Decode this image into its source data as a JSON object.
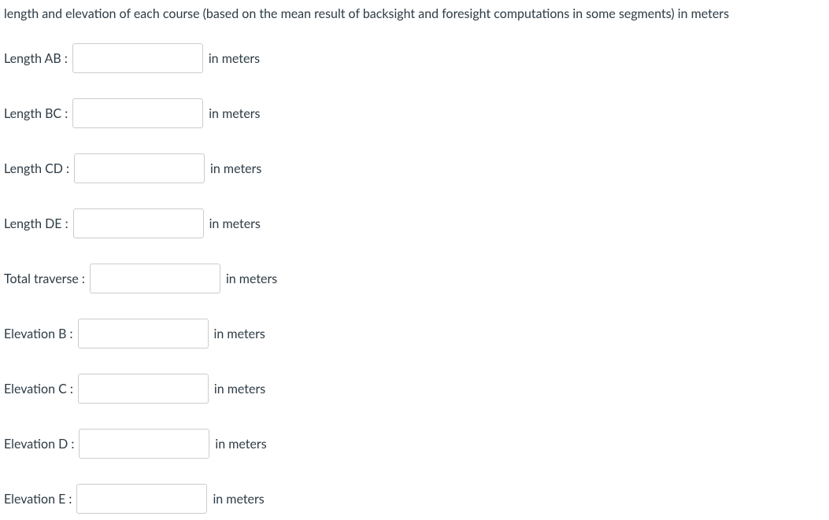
{
  "header": "length and elevation of each course (based on the mean result of backsight and foresight computations in some segments) in meters",
  "fields": {
    "length_ab": {
      "label": "Length AB :",
      "unit": "in meters",
      "value": ""
    },
    "length_bc": {
      "label": "Length BC :",
      "unit": "in meters",
      "value": ""
    },
    "length_cd": {
      "label": "Length CD :",
      "unit": "in meters",
      "value": ""
    },
    "length_de": {
      "label": "Length DE :",
      "unit": "in meters",
      "value": ""
    },
    "total_traverse": {
      "label": "Total traverse :",
      "unit": "in meters",
      "value": ""
    },
    "elevation_b": {
      "label": "Elevation B :",
      "unit": "in meters",
      "value": ""
    },
    "elevation_c": {
      "label": "Elevation C :",
      "unit": "in meters",
      "value": ""
    },
    "elevation_d": {
      "label": "Elevation D :",
      "unit": "in meters",
      "value": ""
    },
    "elevation_e": {
      "label": "Elevation E :",
      "unit": "in meters",
      "value": ""
    }
  }
}
